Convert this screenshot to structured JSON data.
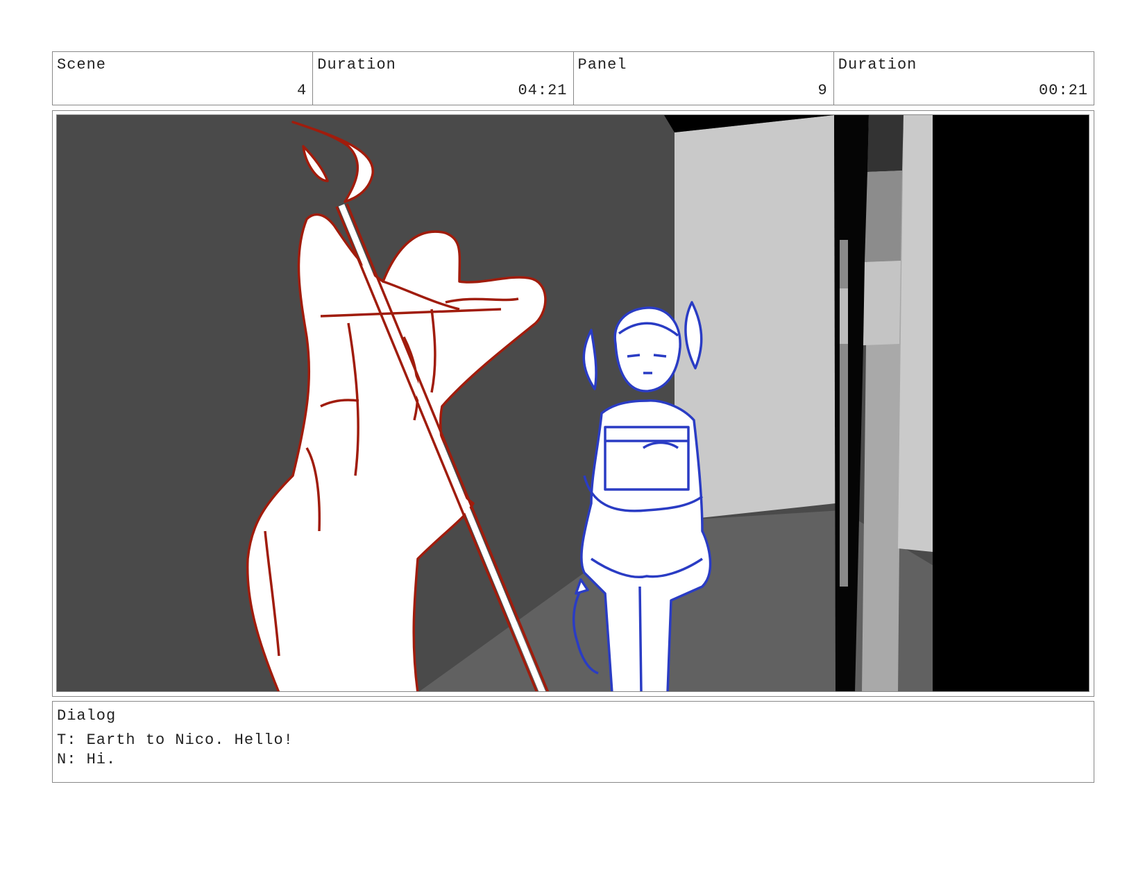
{
  "header": {
    "scene": {
      "label": "Scene",
      "value": "4"
    },
    "scene_duration": {
      "label": "Duration",
      "value": "04:21"
    },
    "panel": {
      "label": "Panel",
      "value": "9"
    },
    "panel_duration": {
      "label": "Duration",
      "value": "00:21"
    }
  },
  "dialog": {
    "label": "Dialog",
    "lines": [
      "T: Earth to Nico. Hello!",
      "N: Hi."
    ]
  },
  "colors": {
    "wall_dark": "#4a4a4a",
    "floor": "#616161",
    "wall_light": "#c8c8c8",
    "character_red": "#a01c0c",
    "character_blue": "#2a3cc4",
    "border": "#888888"
  },
  "icons": {
    "red_figure": "red-demon-figure-sketch",
    "blue_figure": "blue-boy-figure-sketch"
  }
}
